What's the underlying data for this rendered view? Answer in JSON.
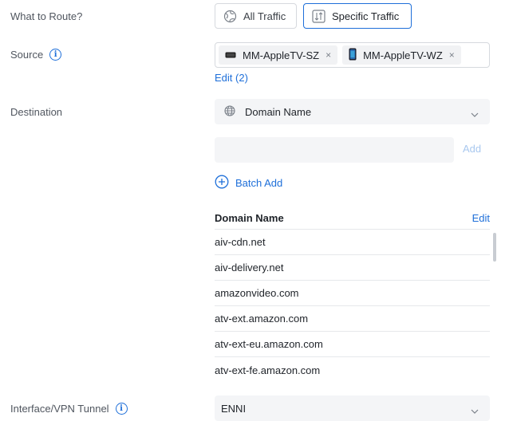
{
  "what_to_route": {
    "label": "What to Route?",
    "options": [
      {
        "label": "All Traffic",
        "selected": false
      },
      {
        "label": "Specific Traffic",
        "selected": true
      }
    ]
  },
  "source": {
    "label": "Source",
    "chips": [
      {
        "label": "MM-AppleTV-SZ",
        "remove": "×"
      },
      {
        "label": "MM-AppleTV-WZ",
        "remove": "×"
      }
    ],
    "edit_link": "Edit (2)"
  },
  "destination": {
    "label": "Destination",
    "type_select": "Domain Name",
    "input_value": "",
    "add_label": "Add",
    "batch_add_label": "Batch Add",
    "table": {
      "header": "Domain Name",
      "edit_label": "Edit",
      "rows": [
        "aiv-cdn.net",
        "aiv-delivery.net",
        "amazonvideo.com",
        "atv-ext.amazon.com",
        "atv-ext-eu.amazon.com",
        "atv-ext-fe.amazon.com"
      ]
    }
  },
  "interface": {
    "label": "Interface/VPN Tunnel",
    "value": "ENNI"
  },
  "colors": {
    "accent": "#1e6fd9",
    "border": "#d6d9de",
    "field_bg": "#f4f5f7"
  }
}
